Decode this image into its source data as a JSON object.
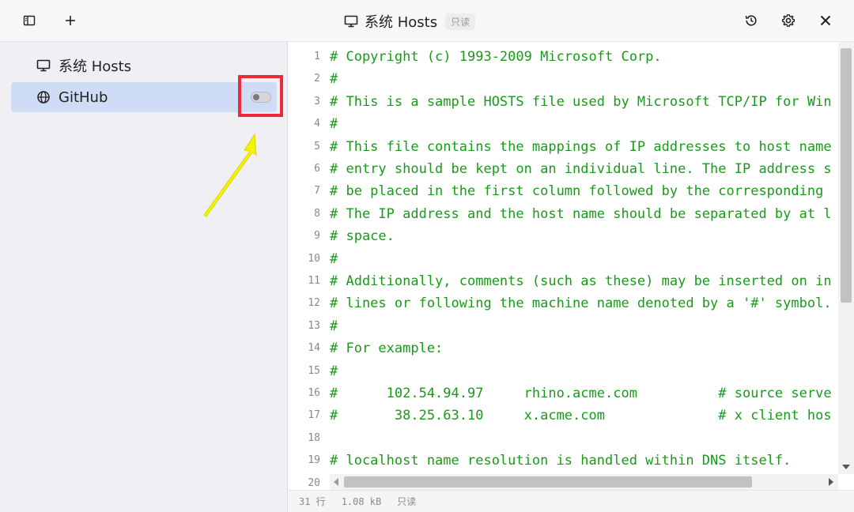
{
  "header": {
    "title": "系统 Hosts",
    "badge": "只读",
    "icons": {
      "sidebar_toggle": "sidebar-icon",
      "add": "plus-icon",
      "title_monitor": "monitor-icon",
      "history": "history-icon",
      "settings": "gear-icon",
      "close": "close-icon"
    }
  },
  "sidebar": {
    "items": [
      {
        "label": "系统 Hosts",
        "icon": "monitor-icon",
        "active": false
      },
      {
        "label": "GitHub",
        "icon": "globe-icon",
        "active": true,
        "toggle_on": false
      }
    ]
  },
  "editor": {
    "lines": [
      {
        "n": "1",
        "text": "# Copyright (c) 1993-2009 Microsoft Corp."
      },
      {
        "n": "2",
        "text": "#"
      },
      {
        "n": "3",
        "text": "# This is a sample HOSTS file used by Microsoft TCP/IP for Win"
      },
      {
        "n": "4",
        "text": "#"
      },
      {
        "n": "5",
        "text": "# This file contains the mappings of IP addresses to host name"
      },
      {
        "n": "6",
        "text": "# entry should be kept on an individual line. The IP address s"
      },
      {
        "n": "7",
        "text": "# be placed in the first column followed by the corresponding "
      },
      {
        "n": "8",
        "text": "# The IP address and the host name should be separated by at l"
      },
      {
        "n": "9",
        "text": "# space."
      },
      {
        "n": "10",
        "text": "#"
      },
      {
        "n": "11",
        "text": "# Additionally, comments (such as these) may be inserted on in"
      },
      {
        "n": "12",
        "text": "# lines or following the machine name denoted by a '#' symbol."
      },
      {
        "n": "13",
        "text": "#"
      },
      {
        "n": "14",
        "text": "# For example:"
      },
      {
        "n": "15",
        "text": "#"
      },
      {
        "n": "16",
        "text": "#      102.54.94.97     rhino.acme.com          # source serve"
      },
      {
        "n": "17",
        "text": "#       38.25.63.10     x.acme.com              # x client hos"
      },
      {
        "n": "18",
        "text": ""
      },
      {
        "n": "19",
        "text": "# localhost name resolution is handled within DNS itself."
      },
      {
        "n": "20",
        "text": ""
      }
    ]
  },
  "status": {
    "lines": "31 行",
    "size": "1.08 kB",
    "mode": "只读"
  },
  "colors": {
    "code": "#1a9a1a",
    "active_item": "#cfdcf5",
    "highlight": "#ee2a36",
    "arrow": "#f4f400"
  }
}
